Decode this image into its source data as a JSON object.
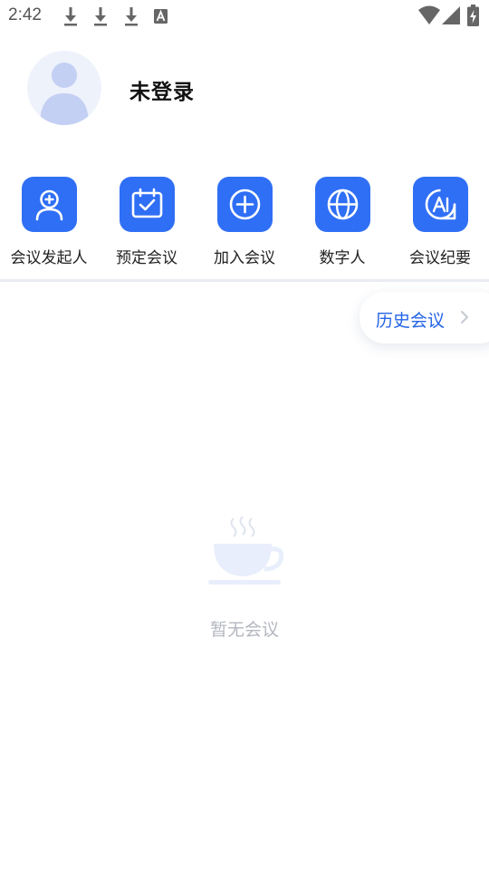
{
  "status_bar": {
    "time": "2:42",
    "icons": [
      "download-icon",
      "download-icon",
      "download-icon",
      "font-icon",
      "wifi-icon",
      "signal-icon",
      "battery-icon"
    ]
  },
  "profile": {
    "login_status": "未登录"
  },
  "actions": [
    {
      "label": "会议发起人",
      "icon": "add-user-icon"
    },
    {
      "label": "预定会议",
      "icon": "calendar-check-icon"
    },
    {
      "label": "加入会议",
      "icon": "plus-circle-icon"
    },
    {
      "label": "数字人",
      "icon": "globe-icon"
    },
    {
      "label": "会议纪要",
      "icon": "minutes-icon"
    }
  ],
  "history_button": {
    "label": "历史会议"
  },
  "empty_state": {
    "text": "暂无会议",
    "icon": "coffee-cup-icon"
  },
  "colors": {
    "accent": "#2f6ff5",
    "link": "#2564e6",
    "muted_text": "#b3b7bf"
  }
}
